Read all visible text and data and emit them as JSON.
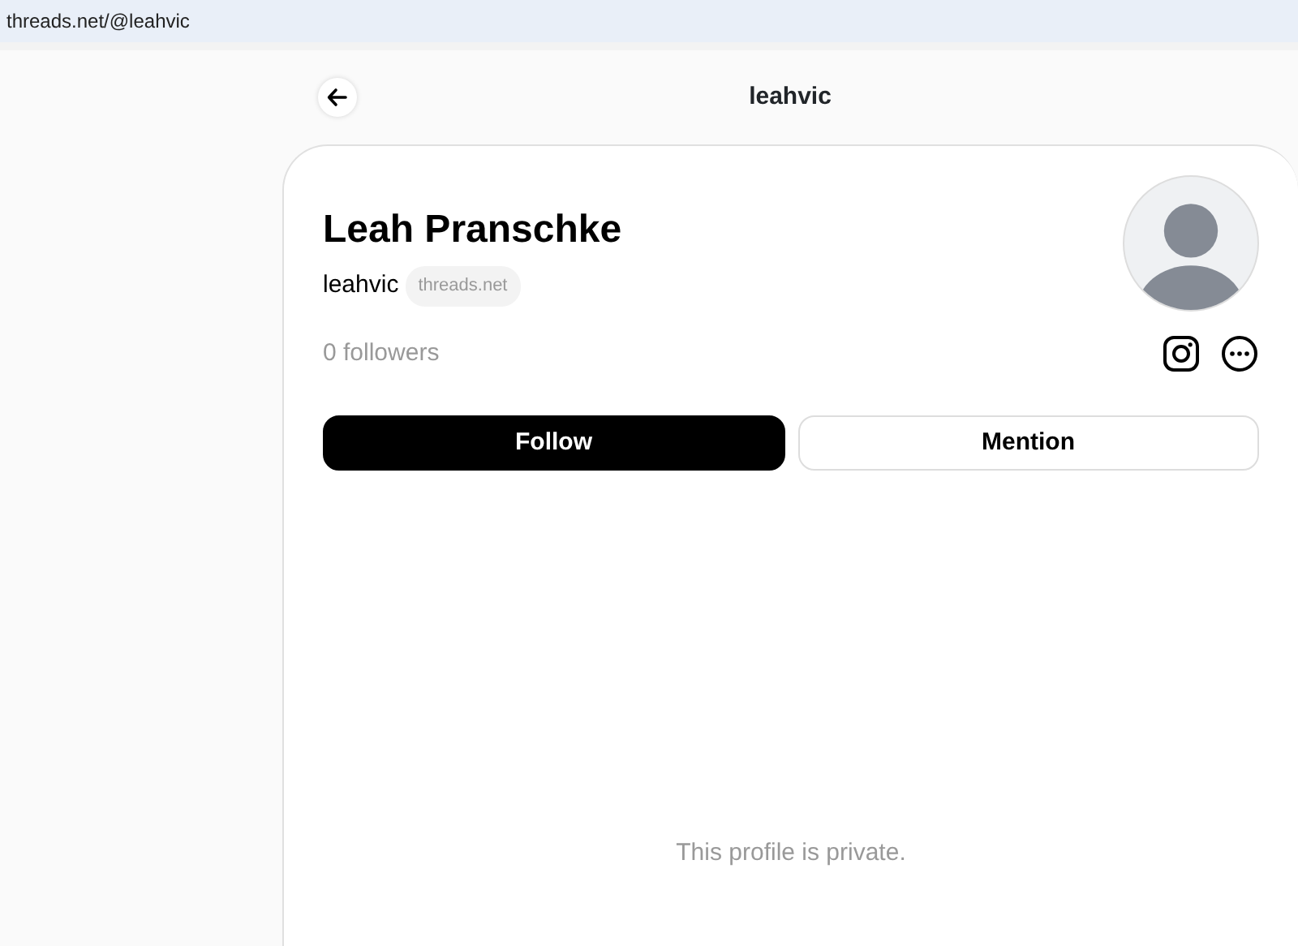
{
  "address_bar": {
    "url": "threads.net/@leahvic"
  },
  "header": {
    "title": "leahvic"
  },
  "profile": {
    "name": "Leah Pranschke",
    "username": "leahvic",
    "domain_badge": "threads.net",
    "followers": "0 followers"
  },
  "buttons": [
    {
      "label": "Follow",
      "kind": "primary"
    },
    {
      "label": "Mention",
      "kind": "outline"
    }
  ],
  "private_notice": "This profile is private."
}
